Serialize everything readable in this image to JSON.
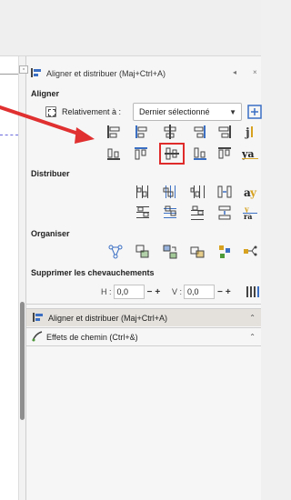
{
  "dock_controls": {
    "left": "◂",
    "close": "×",
    "min": "▫"
  },
  "panel": {
    "title": "Aligner et distribuer (Maj+Ctrl+A)",
    "aligner": {
      "heading": "Aligner",
      "relative_label": "Relativement à :",
      "relative_value": "Dernier sélectionné",
      "dropdown_arrow": "▼"
    },
    "distribuer": {
      "heading": "Distribuer"
    },
    "organiser": {
      "heading": "Organiser"
    },
    "chevauchements": {
      "heading": "Supprimer les chevauchements",
      "h_label": "H :",
      "h_value": "0,0",
      "v_label": "V :",
      "v_value": "0,0",
      "minus": "−",
      "plus": "+"
    }
  },
  "collapsed_panels": [
    {
      "title": "Aligner et distribuer (Maj+Ctrl+A)",
      "chevron": "⌃"
    },
    {
      "title": "Effets de chemin (Ctrl+&)",
      "chevron": "⌃"
    }
  ],
  "colors": {
    "highlight": "#e02b2b",
    "arrow": "#e03030",
    "icon_blue": "#3a6fc4",
    "icon_green": "#4d9a3a",
    "icon_gold": "#d6a21f"
  }
}
